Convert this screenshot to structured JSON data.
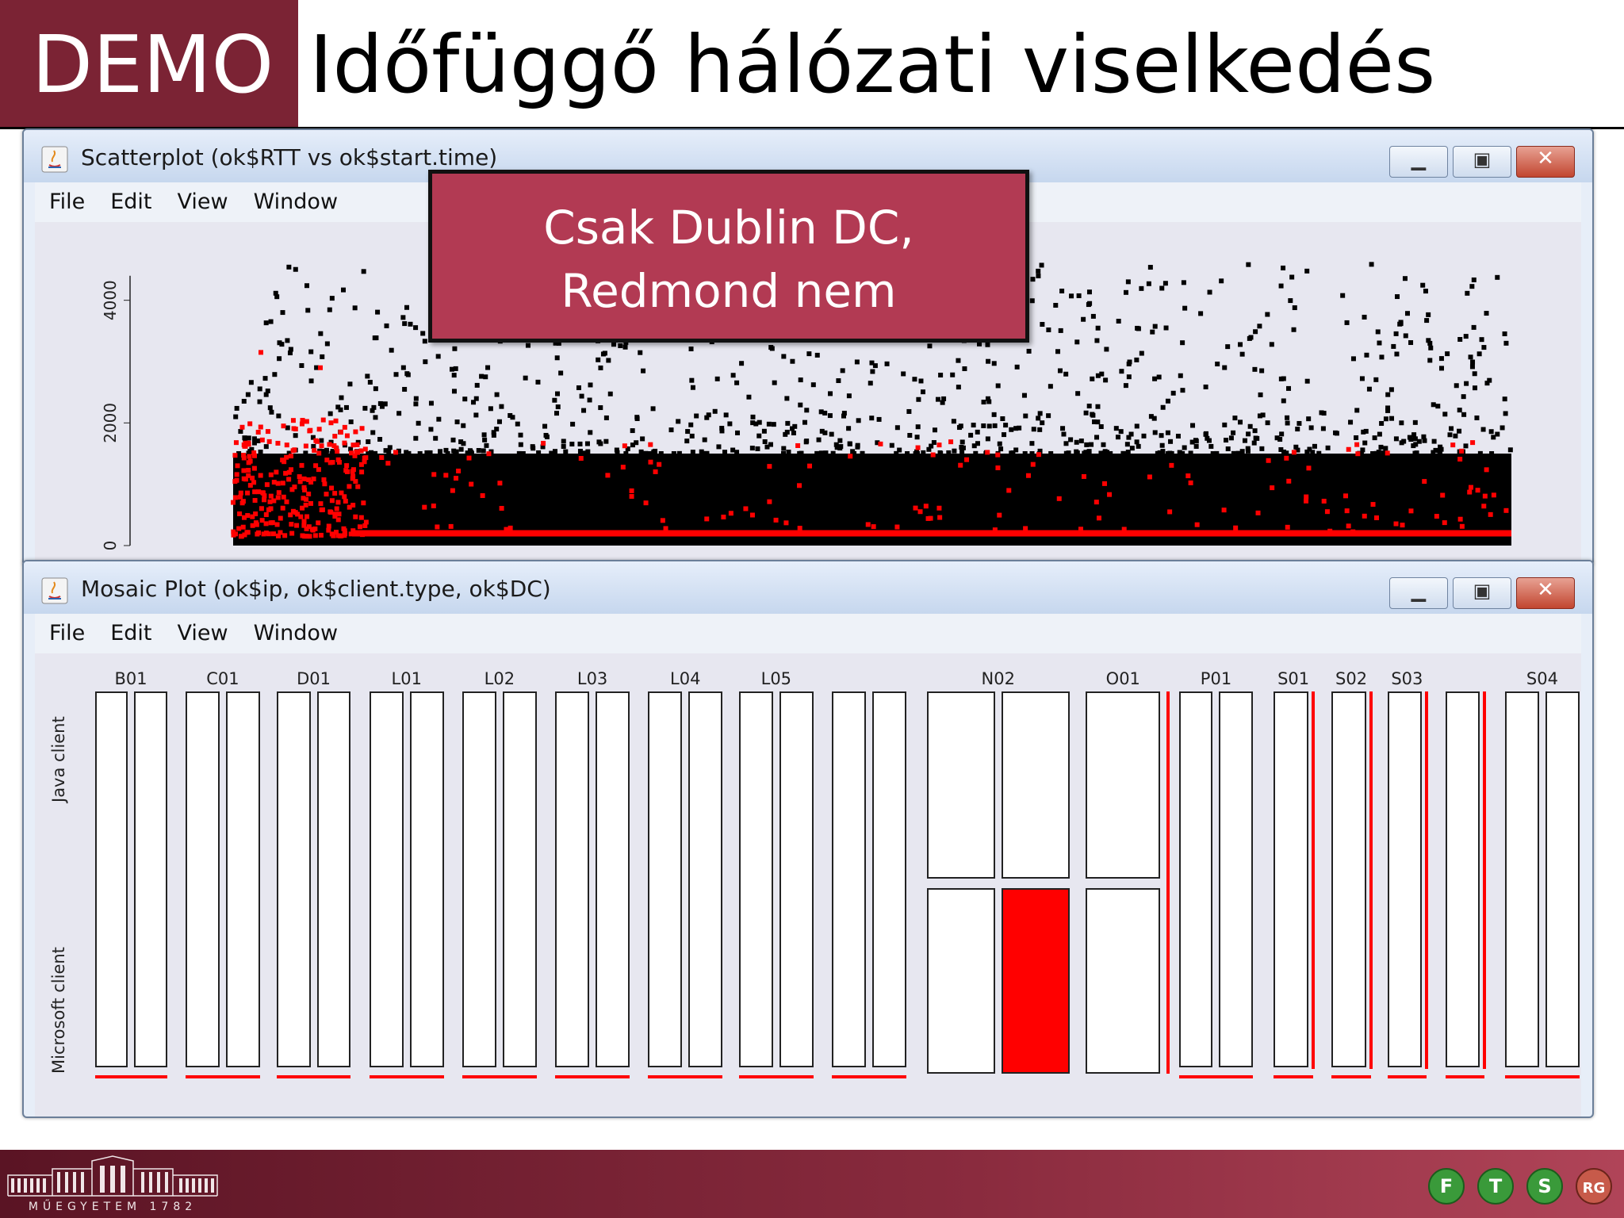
{
  "slide": {
    "tag": "DEMO",
    "title": "Időfüggő hálózati viselkedés",
    "callout_line1": "Csak Dublin DC,",
    "callout_line2": "Redmond nem"
  },
  "scatter_window": {
    "title": "Scatterplot (ok$RTT vs ok$start.time)",
    "menu": [
      "File",
      "Edit",
      "View",
      "Window"
    ],
    "buttons": [
      "minimize",
      "maximize",
      "close"
    ]
  },
  "mosaic_window": {
    "title": "Mosaic Plot (ok$ip, ok$client.type, ok$DC)",
    "menu": [
      "File",
      "Edit",
      "View",
      "Window"
    ],
    "buttons": [
      "minimize",
      "maximize",
      "close"
    ]
  },
  "chart_data": [
    {
      "type": "scatter",
      "ylim": [
        0,
        4500
      ],
      "yticks": [
        "0",
        "2000",
        "4000"
      ],
      "series": [
        {
          "color": "#000000",
          "description_values": {
            "baseline_y": 150,
            "band_top_y": 1500,
            "max_y": 4600
          }
        },
        {
          "color": "#ff0000",
          "description_values": {
            "baseline_y": 200,
            "max_y": 3200
          }
        }
      ]
    },
    {
      "type": "table",
      "subtype": "mosaic",
      "column_labels": [
        "B01",
        "C01",
        "D01",
        "L01",
        "L02",
        "L03",
        "L04",
        "L05",
        "",
        "N02",
        "O01",
        "P01",
        "S01",
        "S02",
        "S03",
        "S04"
      ],
      "row_labels": [
        "Java client",
        "Microsoft client"
      ],
      "highlight_color": "#ff0000",
      "highlighted_cell": {
        "column": "N02",
        "row": "Microsoft client"
      }
    }
  ],
  "colors": {
    "brand": "#7b2334",
    "callout": "#b23a53",
    "highlight": "#ff0000"
  },
  "footer": {
    "left_logo": "MŰEGYETEM 1782",
    "right_logo": "FTSRG"
  }
}
